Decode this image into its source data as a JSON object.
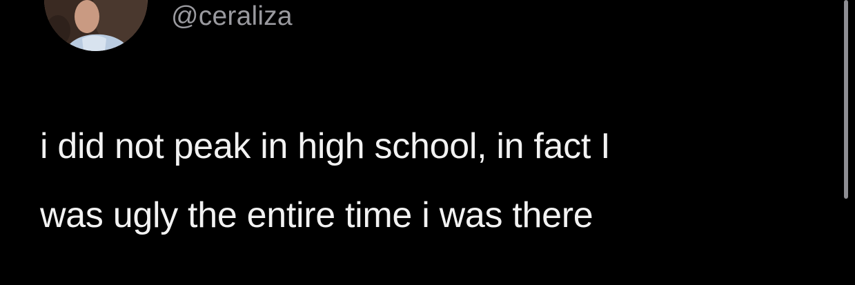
{
  "tweet": {
    "handle": "@ceraliza",
    "text_lines": [
      "i did not peak in high school, in fact I",
      "was ugly the entire time i was there"
    ]
  },
  "colors": {
    "background": "#000000",
    "text": "#f2f2f2",
    "handle": "#9a9a9f",
    "scrollbar": "#8e8e93"
  },
  "icons": {
    "avatar": "profile-photo"
  }
}
